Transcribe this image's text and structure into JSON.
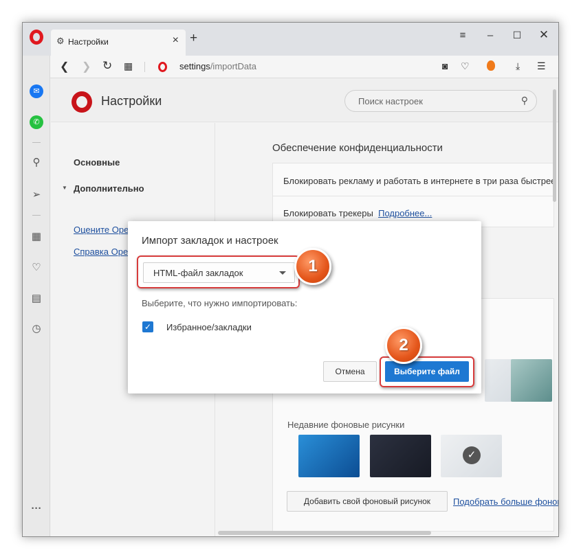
{
  "tab": {
    "title": "Настройки"
  },
  "address": {
    "url_host": "settings",
    "url_path": "/importData"
  },
  "settings": {
    "title": "Настройки",
    "search_placeholder": "Поиск настроек",
    "nav": {
      "basic": "Основные",
      "advanced": "Дополнительно",
      "rate_link": "Оцените Opera",
      "help_link": "Справка Opera"
    },
    "privacy": {
      "section_title": "Обеспечение конфиденциальности",
      "block_ads": "Блокировать рекламу и работать в интернете в три раза быстрее",
      "block_trackers": "Блокировать трекеры",
      "more_link": "Подробнее..."
    },
    "wallpaper": {
      "recent_label": "Недавние фоновые рисунки",
      "add_button": "Добавить свой фоновый рисунок",
      "more_link": "Подобрать больше фоновых рисунков"
    }
  },
  "dialog": {
    "title": "Импорт закладок и настроек",
    "select_value": "HTML-файл закладок",
    "prompt": "Выберите, что нужно импортировать:",
    "checkbox_label": "Избранное/закладки",
    "checkbox_checked": true,
    "cancel_label": "Отмена",
    "choose_label": "Выберите файл"
  },
  "annotations": {
    "badge1": "1",
    "badge2": "2"
  },
  "colors": {
    "accent": "#1e78d2",
    "opera_red": "#e0181f",
    "badge": "#e4561b",
    "highlight": "#d73b3b"
  },
  "icons": {
    "sidebar": [
      "messenger-icon",
      "whatsapp-icon",
      "search-icon",
      "send-icon",
      "speed-dial-icon",
      "heart-icon",
      "news-icon",
      "history-icon",
      "more-icon"
    ]
  }
}
